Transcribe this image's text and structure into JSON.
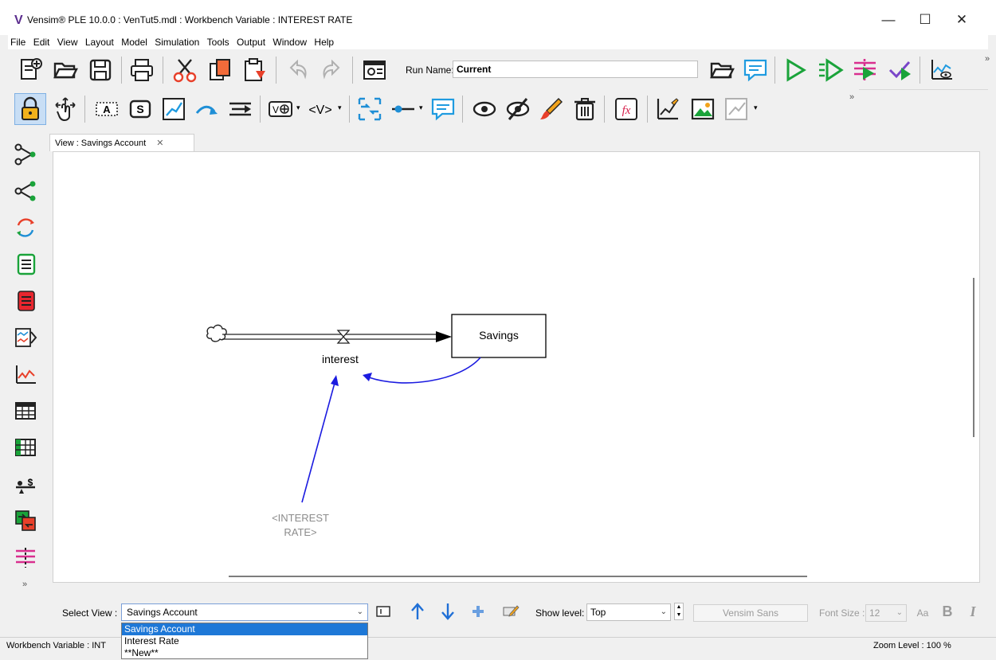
{
  "window": {
    "title": "Vensim® PLE 10.0.0 : VenTut5.mdl : Workbench Variable : INTEREST RATE",
    "logo_letter": "V",
    "minimize": "—",
    "maximize": "☐",
    "close": "✕"
  },
  "menu": [
    "File",
    "Edit",
    "View",
    "Layout",
    "Model",
    "Simulation",
    "Tools",
    "Output",
    "Window",
    "Help"
  ],
  "toolbar": {
    "run_name_label": "Run Name:",
    "run_name_value": "Current",
    "overflow": "»"
  },
  "view_tab": {
    "label": "View : Savings Account",
    "close": "✕"
  },
  "diagram": {
    "stock_label": "Savings",
    "flow_label": "interest",
    "shadow_variable_line1": "<INTEREST",
    "shadow_variable_line2": "RATE>",
    "colors": {
      "link": "#1b1be0",
      "shadow_text": "#8c8c8c"
    }
  },
  "bottom": {
    "select_view_label": "Select View :",
    "select_view_value": "Savings Account",
    "options": [
      "Savings Account",
      "Interest Rate",
      "**New**"
    ],
    "show_level_label": "Show level:",
    "show_level_value": "Top",
    "font_name": "Vensim Sans",
    "font_size_label": "Font Size :",
    "font_size_value": "12",
    "aa": "Aa",
    "bold": "B",
    "italic": "I"
  },
  "status": {
    "left": "Workbench Variable : INT",
    "zoom": "Zoom Level : 100 %"
  },
  "left_palette_more": "»"
}
